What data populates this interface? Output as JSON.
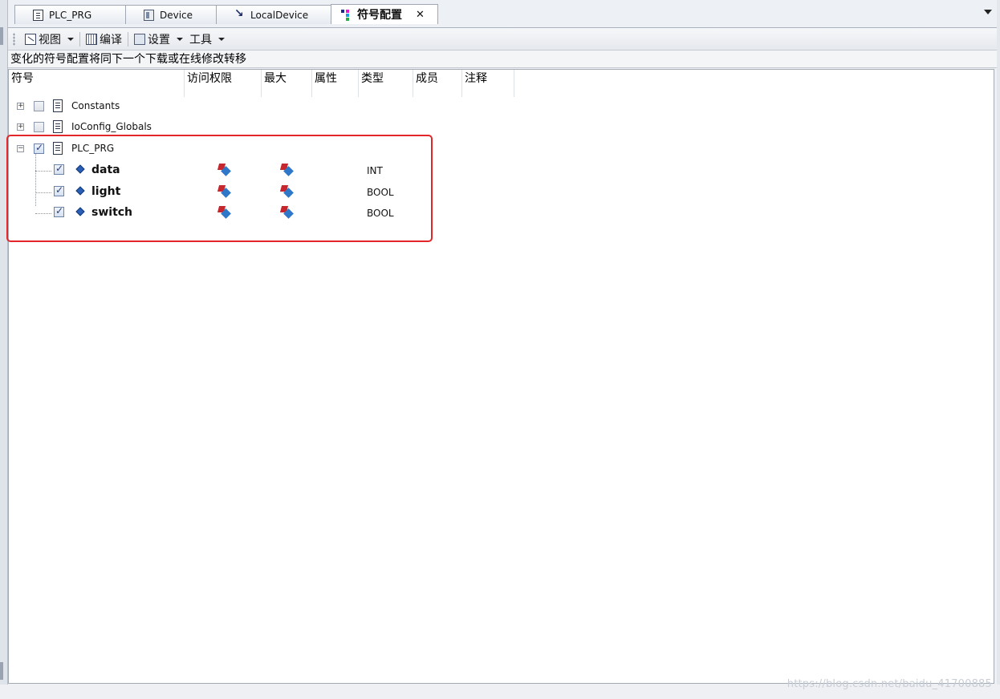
{
  "tabs": [
    {
      "label": "PLC_PRG",
      "icon": "document-icon",
      "active": false
    },
    {
      "label": "Device",
      "icon": "device-icon",
      "active": false
    },
    {
      "label": "LocalDevice",
      "icon": "network-icon",
      "active": false
    },
    {
      "label": "符号配置",
      "icon": "symbol-config-icon",
      "active": true
    }
  ],
  "toolbar": {
    "view_label": "视图",
    "compile_label": "编译",
    "settings_label": "设置",
    "tools_label": "工具"
  },
  "infobar": {
    "message": "变化的符号配置将同下一个下载或在线修改转移"
  },
  "columns": [
    "符号",
    "访问权限",
    "最大",
    "属性",
    "类型",
    "成员",
    "注释"
  ],
  "tree": {
    "nodes": [
      {
        "name": "Constants",
        "checked": false,
        "expanded": false
      },
      {
        "name": "IoConfig_Globals",
        "checked": false,
        "expanded": false
      },
      {
        "name": "PLC_PRG",
        "checked": true,
        "expanded": true
      }
    ],
    "variables": [
      {
        "name": "data",
        "type": "INT",
        "checked": true
      },
      {
        "name": "light",
        "type": "BOOL",
        "checked": true
      },
      {
        "name": "switch",
        "type": "BOOL",
        "checked": true
      }
    ]
  },
  "watermark": "https://blog.csdn.net/baidu_41700885",
  "colors": {
    "highlight": "#e2262a",
    "access_red": "#c6262e",
    "access_blue": "#2f77c8"
  }
}
